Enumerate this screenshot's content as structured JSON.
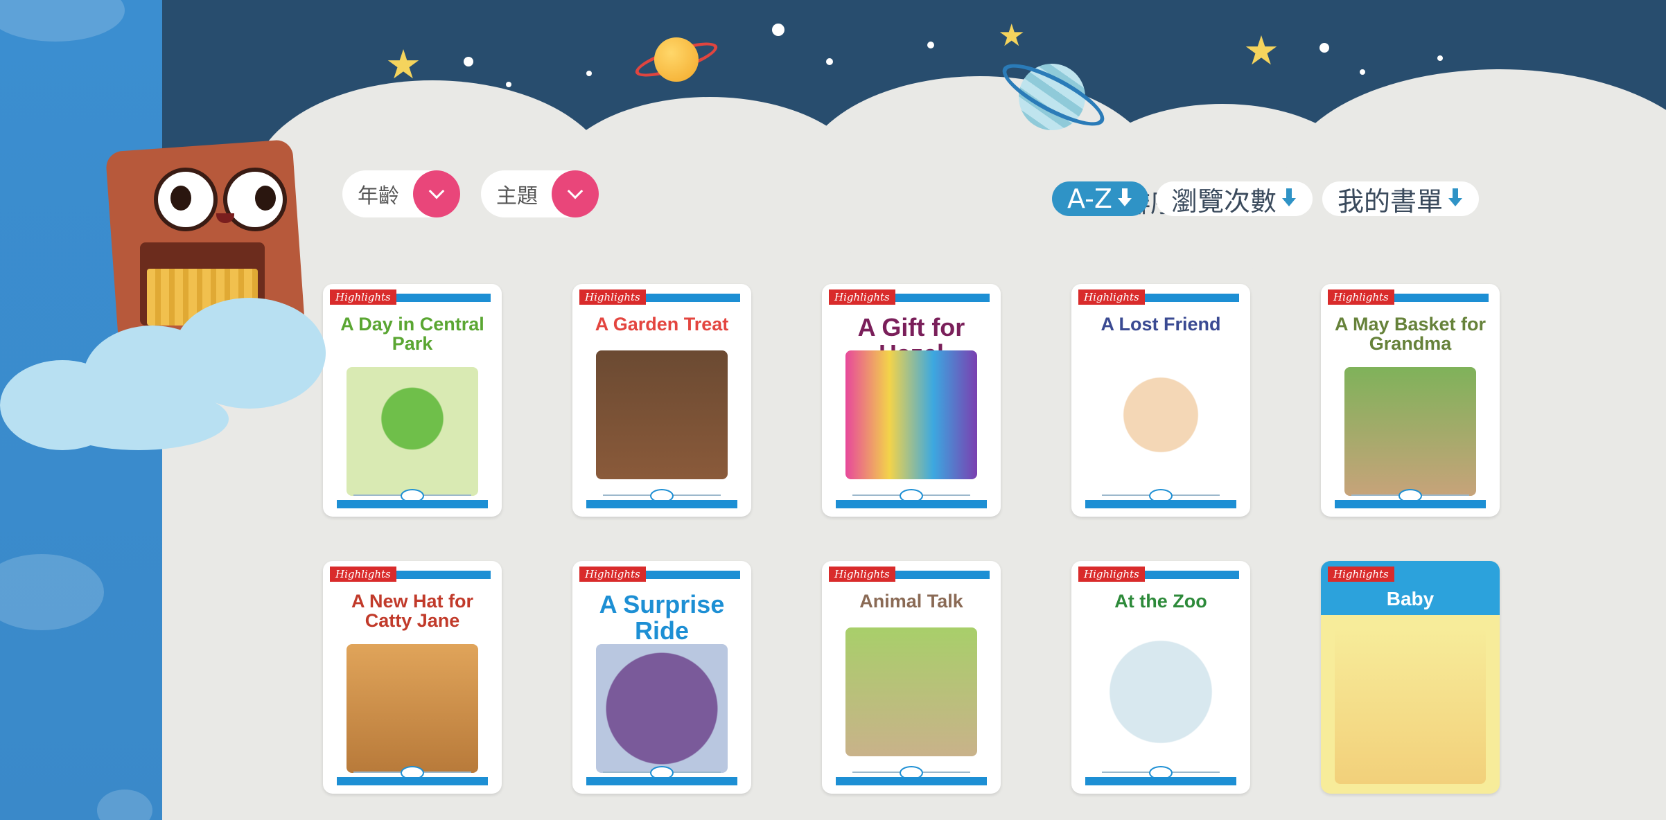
{
  "filters": [
    {
      "label": "年齡"
    },
    {
      "label": "主題"
    }
  ],
  "sort": {
    "label": "排序:",
    "options": [
      {
        "label": "A-Z",
        "active": true
      },
      {
        "label": "瀏覽次數",
        "active": false
      },
      {
        "label": "我的書單",
        "active": false
      }
    ]
  },
  "publisher_badge": "Highlights",
  "books": [
    {
      "title": "A Day in Central Park",
      "title_color": "#5aa632"
    },
    {
      "title": "A Garden Treat",
      "title_color": "#e3453f"
    },
    {
      "title": "A Gift for Hazel",
      "title_color": "#7a1f5a"
    },
    {
      "title": "A Lost Friend",
      "title_color": "#3a4a92"
    },
    {
      "title": "A May Basket for Grandma",
      "title_color": "#66823a"
    },
    {
      "title": "A New Hat for Catty Jane",
      "title_color": "#c13a2a"
    },
    {
      "title": "A Surprise Ride",
      "title_color": "#1d8fd4"
    },
    {
      "title": "Animal Talk",
      "title_color": "#8a6a55"
    },
    {
      "title": "At the Zoo",
      "title_color": "#2d8a3a"
    },
    {
      "title": "Baby",
      "title_color": "#ffffff"
    }
  ],
  "colors": {
    "sky": "#284d6e",
    "page_bg": "#e9e9e6",
    "filter_accent": "#e9467a",
    "sort_active": "#2f93c6"
  }
}
